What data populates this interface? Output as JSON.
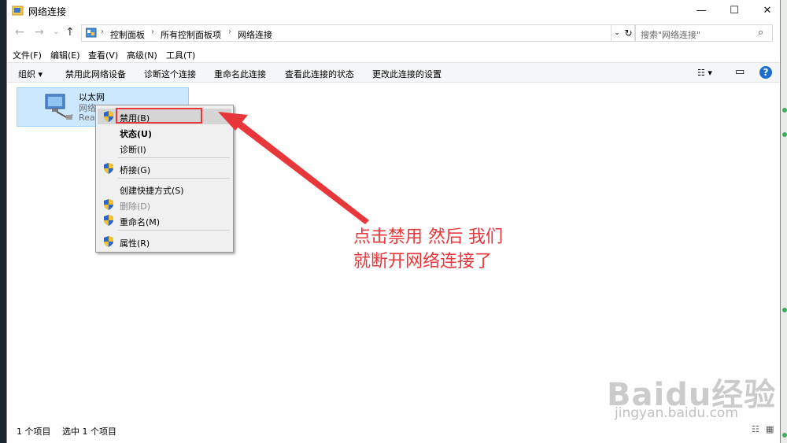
{
  "window": {
    "title": "网络连接",
    "minimize": "—",
    "maximize": "☐",
    "close": "✕"
  },
  "nav": {
    "back": "←",
    "forward": "→",
    "recent": "⌄",
    "up": "↑",
    "breadcrumb_sep": "›",
    "breadcrumb": [
      "控制面板",
      "所有控制面板项",
      "网络连接"
    ],
    "address_dropdown": "⌄",
    "refresh": "↻",
    "search_placeholder": "搜索\"网络连接\"",
    "search_icon": "⌕"
  },
  "menubar": [
    "文件(F)",
    "编辑(E)",
    "查看(V)",
    "高级(N)",
    "工具(T)"
  ],
  "toolbar": {
    "organize": "组织 ▾",
    "commands": [
      "禁用此网络设备",
      "诊断这个连接",
      "重命名此连接",
      "查看此连接的状态",
      "更改此连接的设置"
    ],
    "view_options": "☷ ▾",
    "pane_toggle": "▭",
    "help": "?"
  },
  "adapter": {
    "name": "以太网",
    "line1": "网络",
    "line2": "Rea"
  },
  "context_menu": {
    "items": [
      {
        "label": "禁用(B)",
        "shield": true
      },
      {
        "label": "状态(U)",
        "shield": false,
        "bold": true
      },
      {
        "label": "诊断(I)",
        "shield": false
      },
      {
        "label": "桥接(G)",
        "shield": true
      },
      {
        "label": "创建快捷方式(S)",
        "shield": false
      },
      {
        "label": "删除(D)",
        "shield": true,
        "disabled": true
      },
      {
        "label": "重命名(M)",
        "shield": true
      },
      {
        "label": "属性(R)",
        "shield": true
      }
    ]
  },
  "annotation": {
    "line1": "点击禁用  然后  我们",
    "line2": "就断开网络连接了",
    "color": "#e8373a"
  },
  "status": {
    "count": "1 个项目",
    "selected": "选中 1 个项目",
    "details_view": "☷",
    "icons_view": "▦"
  },
  "watermark": {
    "logo": "Baidu经验",
    "url": "jingyan.baidu.com"
  },
  "colors": {
    "selection": "#cce8ff",
    "accent_blue": "#1c6fd1",
    "highlight_red": "#e8373a"
  }
}
